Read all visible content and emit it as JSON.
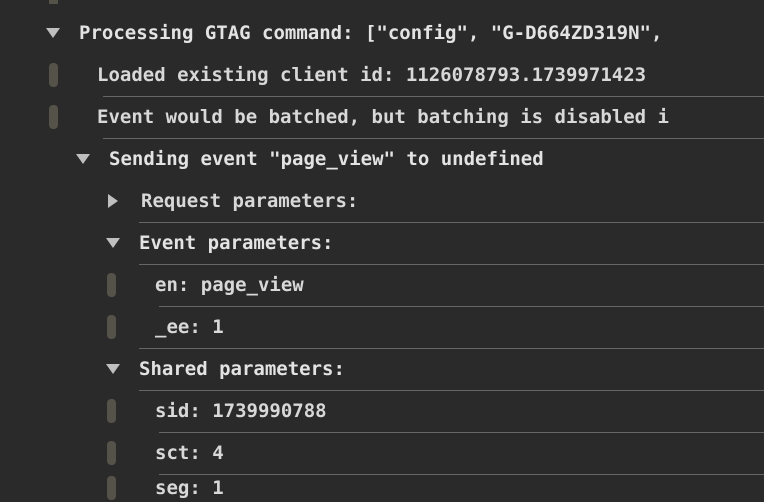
{
  "rows": {
    "gtag_header": "Processing GTAG command: [\"config\", \"G-D664ZD319N\",",
    "loaded_client": "Loaded existing client id: 1126078793.1739971423",
    "batch_disabled": "Event would be batched, but batching is disabled i",
    "sending_event": "Sending event \"page_view\" to undefined",
    "request_params": "Request parameters:",
    "event_params": "Event parameters:",
    "en": "en: page_view",
    "ee": "_ee: 1",
    "shared_params": "Shared parameters:",
    "sid": "sid: 1739990788",
    "sct": "sct: 4",
    "seg": "seg: 1"
  }
}
